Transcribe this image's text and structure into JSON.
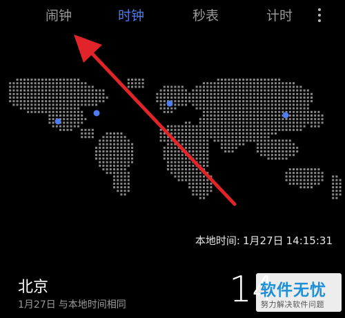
{
  "tabs": [
    {
      "label": "闹钟",
      "active": false
    },
    {
      "label": "时钟",
      "active": true
    },
    {
      "label": "秒表",
      "active": false
    },
    {
      "label": "计时",
      "active": false
    }
  ],
  "more_icon": "more-vertical-icon",
  "local_time": {
    "label": "本地时间:",
    "date": "1月27日",
    "time": "14:15:31"
  },
  "city": {
    "name": "北京",
    "date": "1月27日",
    "diff": "与本地时间相同",
    "time": "14"
  },
  "watermark": {
    "title": "软件无忧",
    "subtitle": "努力解决软件问题"
  },
  "colors": {
    "accent": "#4f7cf0",
    "arrow": "#e0242a",
    "map_dot": "#8a8a8a",
    "city_dot": "#4f7cf0"
  }
}
